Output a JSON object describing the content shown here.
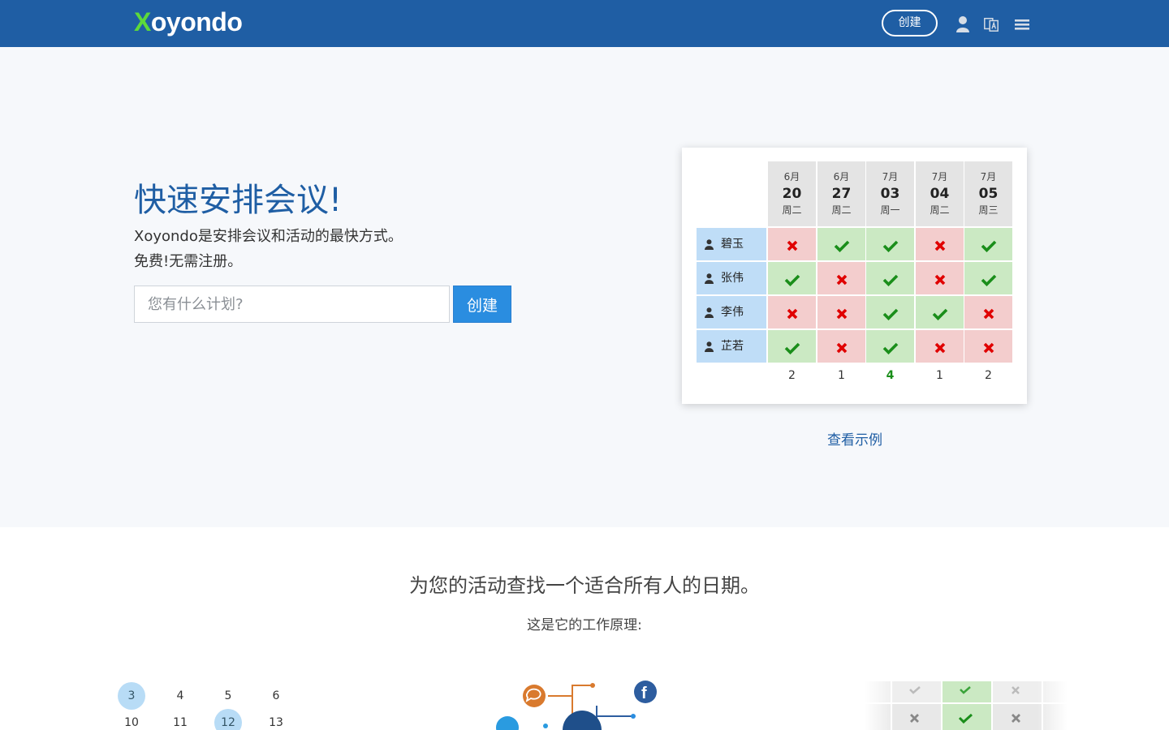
{
  "header": {
    "logo_x": "X",
    "logo_rest": "oyondo",
    "create_label": "创建",
    "icons": [
      "user-icon",
      "language-icon",
      "menu-icon"
    ]
  },
  "hero": {
    "title": "快速安排会议!",
    "desc_line1": "Xoyondo是安排会议和活动的最快方式。",
    "desc_line2": "免费!无需注册。",
    "input_placeholder": "您有什么计划?",
    "create_button": "创建",
    "example_link": "查看示例"
  },
  "poll": {
    "dates": [
      {
        "month": "6月",
        "day": "20",
        "weekday": "周二"
      },
      {
        "month": "6月",
        "day": "27",
        "weekday": "周二"
      },
      {
        "month": "7月",
        "day": "03",
        "weekday": "周一"
      },
      {
        "month": "7月",
        "day": "04",
        "weekday": "周二"
      },
      {
        "month": "7月",
        "day": "05",
        "weekday": "周三"
      }
    ],
    "participants": [
      {
        "name": "碧玉",
        "votes": [
          false,
          true,
          true,
          false,
          true
        ]
      },
      {
        "name": "张伟",
        "votes": [
          true,
          false,
          true,
          false,
          true
        ]
      },
      {
        "name": "李伟",
        "votes": [
          false,
          false,
          true,
          true,
          false
        ]
      },
      {
        "name": "芷若",
        "votes": [
          true,
          false,
          true,
          false,
          false
        ]
      }
    ],
    "totals": [
      "2",
      "1",
      "4",
      "1",
      "2"
    ],
    "best_index": 2,
    "colors": {
      "yes": "#1a8e1a",
      "no": "#e00000",
      "yes_bg": "#cbe9c3",
      "no_bg": "#f3cdcd"
    }
  },
  "lower": {
    "title": "为您的活动查找一个适合所有人的日期。",
    "subtitle": "这是它的工作原理:",
    "calendar_numbers": [
      "3",
      "4",
      "5",
      "6",
      "10",
      "11",
      "12",
      "13"
    ],
    "calendar_selected": [
      "3",
      "12"
    ]
  },
  "colors": {
    "brand": "#1f5ea4",
    "accent": "#2a8de0",
    "logo_x": "#5dd93a"
  }
}
